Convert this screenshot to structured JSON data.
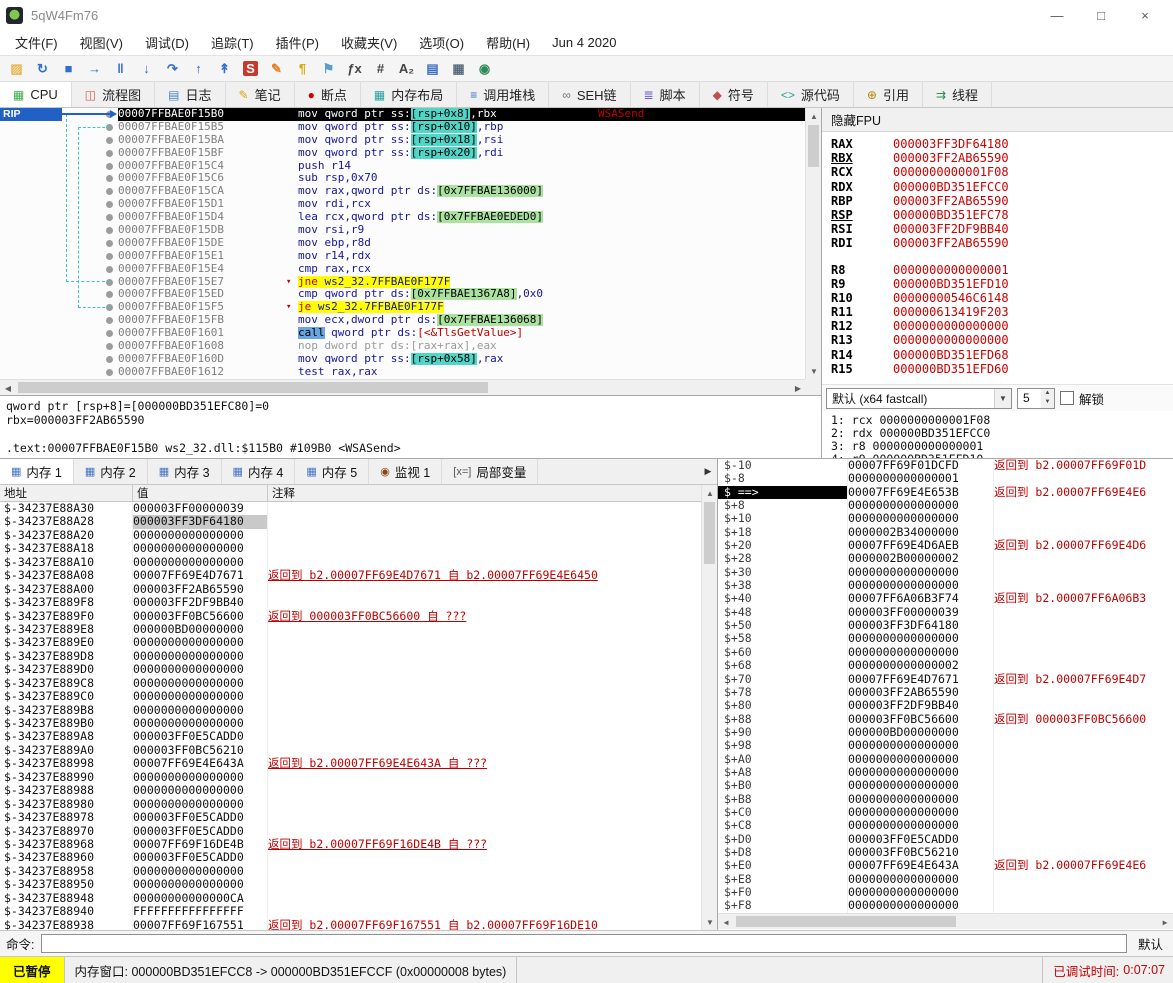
{
  "window": {
    "title": "5qW4Fm76",
    "min": "—",
    "max": "□",
    "close": "×"
  },
  "menu": {
    "items": [
      "文件(F)",
      "视图(V)",
      "调试(D)",
      "追踪(T)",
      "插件(P)",
      "收藏夹(V)",
      "选项(O)",
      "帮助(H)",
      "Jun 4 2020"
    ]
  },
  "toolbar": {
    "icons": [
      {
        "name": "open-file-icon",
        "glyph": "▨",
        "color": "#e8b64c"
      },
      {
        "name": "restart-icon",
        "glyph": "↻",
        "color": "#2f6fd0"
      },
      {
        "name": "stop-icon",
        "glyph": "■",
        "color": "#2f6fd0"
      },
      {
        "name": "run-icon",
        "glyph": "→",
        "color": "#2f6fd0"
      },
      {
        "name": "pause-icon",
        "glyph": "‖",
        "color": "#2f6fd0"
      },
      {
        "name": "step-into-icon",
        "glyph": "↓",
        "color": "#2f6fd0"
      },
      {
        "name": "step-over-icon",
        "glyph": "↷",
        "color": "#2f6fd0"
      },
      {
        "name": "execute-till-return-icon",
        "glyph": "↑",
        "color": "#2f6fd0"
      },
      {
        "name": "run-to-user-code-icon",
        "glyph": "↟",
        "color": "#2f6fd0"
      },
      {
        "name": "scylla-icon",
        "glyph": "S",
        "color": "#ffffff",
        "bg": "#c23b2e"
      },
      {
        "name": "patches-icon",
        "glyph": "✎",
        "color": "#e67e22"
      },
      {
        "name": "comments-icon",
        "glyph": "¶",
        "color": "#d8a800"
      },
      {
        "name": "labels-icon",
        "glyph": "⚑",
        "color": "#5b9bd5"
      },
      {
        "name": "calculator-icon",
        "glyph": "ƒx",
        "color": "#444444"
      },
      {
        "name": "hash-icon",
        "glyph": "#",
        "color": "#444444"
      },
      {
        "name": "az-icon",
        "glyph": "A₂",
        "color": "#444444"
      },
      {
        "name": "modules-icon",
        "glyph": "▤",
        "color": "#3a6fc4"
      },
      {
        "name": "memory-map-icon",
        "glyph": "▦",
        "color": "#5a6b7d"
      },
      {
        "name": "settings-icon",
        "glyph": "◉",
        "color": "#2e8b57"
      }
    ]
  },
  "tabs": {
    "items": [
      {
        "label": "CPU",
        "glyph": "▦",
        "color": "#3fae49",
        "cls": "active"
      },
      {
        "label": "流程图",
        "glyph": "◫",
        "color": "#e2574c"
      },
      {
        "label": "日志",
        "glyph": "▤",
        "color": "#4a86c8"
      },
      {
        "label": "笔记",
        "glyph": "✎",
        "color": "#d8a800"
      },
      {
        "label": "断点",
        "glyph": "●",
        "color": "#cc0000"
      },
      {
        "label": "内存布局",
        "glyph": "▦",
        "color": "#29a3a3"
      },
      {
        "label": "调用堆栈",
        "glyph": "≡",
        "color": "#3a6fc4"
      },
      {
        "label": "SEH链",
        "glyph": "∞",
        "color": "#777777"
      },
      {
        "label": "脚本",
        "glyph": "≣",
        "color": "#6a5acd"
      },
      {
        "label": "符号",
        "glyph": "◆",
        "color": "#c0504d"
      },
      {
        "label": "源代码",
        "glyph": "<>",
        "color": "#2aa198"
      },
      {
        "label": "引用",
        "glyph": "⊕",
        "color": "#b8860b"
      },
      {
        "label": "线程",
        "glyph": "⇉",
        "color": "#2e8b57"
      }
    ]
  },
  "disasm": {
    "rip_label": "RIP",
    "rows": [
      {
        "a": "00007FFBAE0F15B0",
        "t": "mov qword ptr ss:[rsp+0x8],rbx",
        "cls": "sel",
        "cmt": "WSASend"
      },
      {
        "a": "00007FFBAE0F15B5",
        "t": "mov qword ptr ss:[rsp+0x10],rbp"
      },
      {
        "a": "00007FFBAE0F15BA",
        "t": "mov qword ptr ss:[rsp+0x18],rsi"
      },
      {
        "a": "00007FFBAE0F15BF",
        "t": "mov qword ptr ss:[rsp+0x20],rdi"
      },
      {
        "a": "00007FFBAE0F15C4",
        "t": "push r14"
      },
      {
        "a": "00007FFBAE0F15C6",
        "t": "sub rsp,0x70"
      },
      {
        "a": "00007FFBAE0F15CA",
        "t": "mov rax,qword ptr ds:[0x7FFBAE136000]"
      },
      {
        "a": "00007FFBAE0F15D1",
        "t": "mov rdi,rcx"
      },
      {
        "a": "00007FFBAE0F15D4",
        "t": "lea rcx,qword ptr ds:[0x7FFBAE0EDED0]"
      },
      {
        "a": "00007FFBAE0F15DB",
        "t": "mov rsi,r9"
      },
      {
        "a": "00007FFBAE0F15DE",
        "t": "mov ebp,r8d"
      },
      {
        "a": "00007FFBAE0F15E1",
        "t": "mov r14,rdx"
      },
      {
        "a": "00007FFBAE0F15E4",
        "t": "cmp rax,rcx"
      },
      {
        "a": "00007FFBAE0F15E7",
        "t": "jne ws2_32.7FFBAE0F177F",
        "cls": "jmp",
        "j": "▾"
      },
      {
        "a": "00007FFBAE0F15ED",
        "t": "cmp qword ptr ds:[0x7FFBAE1367A8],0x0"
      },
      {
        "a": "00007FFBAE0F15F5",
        "t": "je ws2_32.7FFBAE0F177F",
        "cls": "jmp",
        "j": "▾"
      },
      {
        "a": "00007FFBAE0F15FB",
        "t": "mov ecx,dword ptr ds:[0x7FFBAE136068]"
      },
      {
        "a": "00007FFBAE0F1601",
        "t": "call qword ptr ds:[<&TlsGetValue>]"
      },
      {
        "a": "00007FFBAE0F1608",
        "t": "nop dword ptr ds:[rax+rax],eax",
        "cls": "dim"
      },
      {
        "a": "00007FFBAE0F160D",
        "t": "mov qword ptr ss:[rsp+0x58],rax"
      },
      {
        "a": "00007FFBAE0F1612",
        "t": "test rax,rax"
      }
    ]
  },
  "info": {
    "l1": "qword ptr [rsp+8]=[000000BD351EFC80]=0",
    "l2": "rbx=000003FF2AB65590",
    "l3": ".text:00007FFBAE0F15B0 ws2_32.dll:$115B0 #109B0 <WSASend>"
  },
  "regs": {
    "fpu_label": "隐藏FPU",
    "items": [
      {
        "n": "RAX",
        "v": "000003FF3DF64180"
      },
      {
        "n": "RBX",
        "v": "000003FF2AB65590",
        "u": "u"
      },
      {
        "n": "RCX",
        "v": "0000000000001F08"
      },
      {
        "n": "RDX",
        "v": "000000BD351EFCC0"
      },
      {
        "n": "RBP",
        "v": "000003FF2AB65590"
      },
      {
        "n": "RSP",
        "v": "000000BD351EFC78",
        "u": "u"
      },
      {
        "n": "RSI",
        "v": "000003FF2DF9BB40"
      },
      {
        "n": "RDI",
        "v": "000003FF2AB65590"
      },
      {
        "cls": "gap"
      },
      {
        "n": "R8",
        "v": "0000000000000001"
      },
      {
        "n": "R9",
        "v": "000000BD351EFD10"
      },
      {
        "n": "R10",
        "v": "00000000546C6148"
      },
      {
        "n": "R11",
        "v": "000000613419F203"
      },
      {
        "n": "R12",
        "v": "0000000000000000"
      },
      {
        "n": "R13",
        "v": "0000000000000000"
      },
      {
        "n": "R14",
        "v": "000000BD351EFD68"
      },
      {
        "n": "R15",
        "v": "000000BD351EFD60"
      }
    ],
    "callconv_label": "默认 (x64 fastcall)",
    "callconv_count": "5",
    "unlock_label": "解锁",
    "args": [
      "1: rcx 0000000000001F08",
      "2: rdx 000000BD351EFCC0",
      "3: r8 0000000000000001",
      "4: r9 000000BD351EFD10"
    ]
  },
  "bottom_tabs": {
    "nav": "▶",
    "items": [
      {
        "label": "内存 1",
        "glyph": "▦",
        "color": "#4472c4",
        "cls": "active"
      },
      {
        "label": "内存 2",
        "glyph": "▦",
        "color": "#4472c4"
      },
      {
        "label": "内存 3",
        "glyph": "▦",
        "color": "#4472c4"
      },
      {
        "label": "内存 4",
        "glyph": "▦",
        "color": "#4472c4"
      },
      {
        "label": "内存 5",
        "glyph": "▦",
        "color": "#4472c4"
      },
      {
        "label": "监视 1",
        "glyph": "◉",
        "color": "#8b4513"
      },
      {
        "label": "局部变量",
        "glyph": "[x=]",
        "color": "#555555"
      }
    ]
  },
  "memory": {
    "headers": {
      "addr": "地址",
      "value": "值",
      "comment": "注释"
    },
    "rows": [
      {
        "a": "$-34237E88A30",
        "v": "000003FF00000039"
      },
      {
        "a": "$-34237E88A28",
        "v": "000003FF3DF64180",
        "vcls": "hl"
      },
      {
        "a": "$-34237E88A20",
        "v": "0000000000000000"
      },
      {
        "a": "$-34237E88A18",
        "v": "0000000000000000"
      },
      {
        "a": "$-34237E88A10",
        "v": "0000000000000000"
      },
      {
        "a": "$-34237E88A08",
        "v": "00007FF69E4D7671",
        "c": "返回到 b2.00007FF69E4D7671 自 b2.00007FF69E4E6450"
      },
      {
        "a": "$-34237E88A00",
        "v": "000003FF2AB65590"
      },
      {
        "a": "$-34237E889F8",
        "v": "000003FF2DF9BB40"
      },
      {
        "a": "$-34237E889F0",
        "v": "000003FF0BC56600",
        "c": "返回到 000003FF0BC56600 自 ???"
      },
      {
        "a": "$-34237E889E8",
        "v": "000000BD00000000"
      },
      {
        "a": "$-34237E889E0",
        "v": "0000000000000000"
      },
      {
        "a": "$-34237E889D8",
        "v": "0000000000000000"
      },
      {
        "a": "$-34237E889D0",
        "v": "0000000000000000"
      },
      {
        "a": "$-34237E889C8",
        "v": "0000000000000000"
      },
      {
        "a": "$-34237E889C0",
        "v": "0000000000000000"
      },
      {
        "a": "$-34237E889B8",
        "v": "0000000000000000"
      },
      {
        "a": "$-34237E889B0",
        "v": "0000000000000000"
      },
      {
        "a": "$-34237E889A8",
        "v": "000003FF0E5CADD0"
      },
      {
        "a": "$-34237E889A0",
        "v": "000003FF0BC56210"
      },
      {
        "a": "$-34237E88998",
        "v": "00007FF69E4E643A",
        "c": "返回到 b2.00007FF69E4E643A 自 ???"
      },
      {
        "a": "$-34237E88990",
        "v": "0000000000000000"
      },
      {
        "a": "$-34237E88988",
        "v": "0000000000000000"
      },
      {
        "a": "$-34237E88980",
        "v": "0000000000000000"
      },
      {
        "a": "$-34237E88978",
        "v": "000003FF0E5CADD0"
      },
      {
        "a": "$-34237E88970",
        "v": "000003FF0E5CADD0"
      },
      {
        "a": "$-34237E88968",
        "v": "00007FF69F16DE4B",
        "c": "返回到 b2.00007FF69F16DE4B 自 ???"
      },
      {
        "a": "$-34237E88960",
        "v": "000003FF0E5CADD0"
      },
      {
        "a": "$-34237E88958",
        "v": "0000000000000000"
      },
      {
        "a": "$-34237E88950",
        "v": "0000000000000000"
      },
      {
        "a": "$-34237E88948",
        "v": "00000000000000CA"
      },
      {
        "a": "$-34237E88940",
        "v": "FFFFFFFFFFFFFFFF"
      },
      {
        "a": "$-34237E88938",
        "v": "00007FF69F167551",
        "c": "返回到 b2.00007FF69F167551 自 b2.00007FF69F16DE10"
      }
    ]
  },
  "stack": {
    "rows": [
      {
        "o": "$-10",
        "v": "00007FF69F01DCFD",
        "c": "返回到 b2.00007FF69F01D"
      },
      {
        "o": "$-8",
        "v": "0000000000000001"
      },
      {
        "o": "$ ==>",
        "v": "00007FF69E4E653B",
        "ocls": "cur",
        "c": "返回到 b2.00007FF69E4E6"
      },
      {
        "o": "$+8",
        "v": "0000000000000000"
      },
      {
        "o": "$+10",
        "v": "0000000000000000"
      },
      {
        "o": "$+18",
        "v": "0000002B34000000"
      },
      {
        "o": "$+20",
        "v": "00007FF69E4D6AEB",
        "c": "返回到 b2.00007FF69E4D6"
      },
      {
        "o": "$+28",
        "v": "0000002B00000002"
      },
      {
        "o": "$+30",
        "v": "0000000000000000"
      },
      {
        "o": "$+38",
        "v": "0000000000000000"
      },
      {
        "o": "$+40",
        "v": "00007FF6A06B3F74",
        "c": "返回到 b2.00007FF6A06B3"
      },
      {
        "o": "$+48",
        "v": "000003FF00000039"
      },
      {
        "o": "$+50",
        "v": "000003FF3DF64180"
      },
      {
        "o": "$+58",
        "v": "0000000000000000"
      },
      {
        "o": "$+60",
        "v": "0000000000000000"
      },
      {
        "o": "$+68",
        "v": "0000000000000002"
      },
      {
        "o": "$+70",
        "v": "00007FF69E4D7671",
        "c": "返回到 b2.00007FF69E4D7"
      },
      {
        "o": "$+78",
        "v": "000003FF2AB65590"
      },
      {
        "o": "$+80",
        "v": "000003FF2DF9BB40"
      },
      {
        "o": "$+88",
        "v": "000003FF0BC56600",
        "c": "返回到 000003FF0BC56600"
      },
      {
        "o": "$+90",
        "v": "000000BD00000000"
      },
      {
        "o": "$+98",
        "v": "0000000000000000"
      },
      {
        "o": "$+A0",
        "v": "0000000000000000"
      },
      {
        "o": "$+A8",
        "v": "0000000000000000"
      },
      {
        "o": "$+B0",
        "v": "0000000000000000"
      },
      {
        "o": "$+B8",
        "v": "0000000000000000"
      },
      {
        "o": "$+C0",
        "v": "0000000000000000"
      },
      {
        "o": "$+C8",
        "v": "0000000000000000"
      },
      {
        "o": "$+D0",
        "v": "000003FF0E5CADD0"
      },
      {
        "o": "$+D8",
        "v": "000003FF0BC56210"
      },
      {
        "o": "$+E0",
        "v": "00007FF69E4E643A",
        "c": "返回到 b2.00007FF69E4E6"
      },
      {
        "o": "$+E8",
        "v": "0000000000000000"
      },
      {
        "o": "$+F0",
        "v": "0000000000000000"
      },
      {
        "o": "$+F8",
        "v": "0000000000000000"
      }
    ]
  },
  "command": {
    "label": "命令:",
    "preset": "默认"
  },
  "status": {
    "paused": "已暂停",
    "memwin": "内存窗口: 000000BD351EFCC8 -> 000000BD351EFCCF (0x00000008 bytes)",
    "time_label": "已调试时间:",
    "time": "0:07:07"
  }
}
